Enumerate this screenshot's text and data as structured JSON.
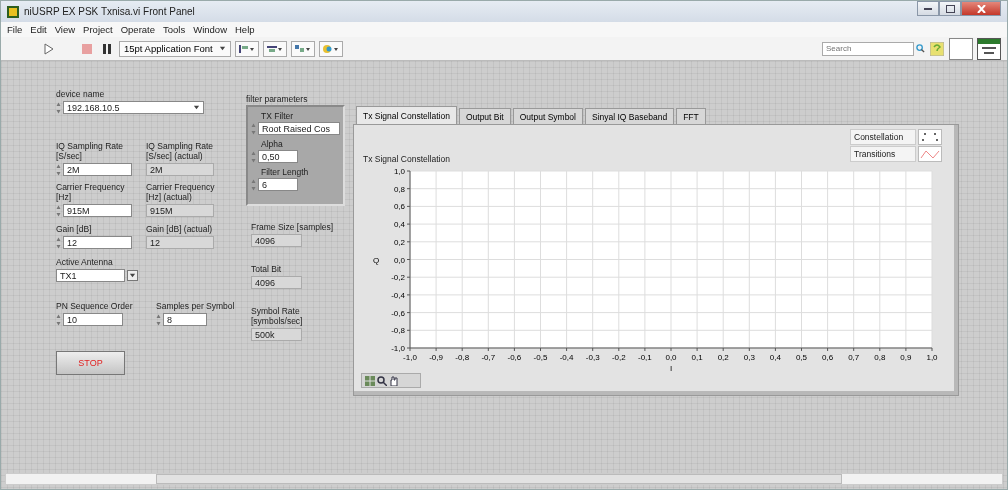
{
  "window": {
    "title": "niUSRP EX PSK Txnisa.vi Front Panel"
  },
  "menu": [
    "File",
    "Edit",
    "View",
    "Project",
    "Operate",
    "Tools",
    "Window",
    "Help"
  ],
  "toolbar": {
    "font": "15pt Application Font",
    "search": {
      "placeholder": "Search"
    }
  },
  "controls": [
    {
      "kind": "ring",
      "label": "device name",
      "value": "192.168.10.5"
    },
    {
      "kind": "numeric",
      "label": "IQ Sampling Rate [S/sec]",
      "value": "2M"
    },
    {
      "kind": "indicator",
      "label": "IQ Sampling Rate [S/sec] (actual)",
      "value": "2M"
    },
    {
      "kind": "numeric",
      "label": "Carrier Frequency [Hz]",
      "value": "915M"
    },
    {
      "kind": "indicator",
      "label": "Carrier Frequency [Hz] (actual)",
      "value": "915M"
    },
    {
      "kind": "numeric",
      "label": "Gain [dB]",
      "value": "12"
    },
    {
      "kind": "indicator",
      "label": "Gain [dB] (actual)",
      "value": "12"
    },
    {
      "kind": "enum",
      "label": "Active Antenna",
      "value": "TX1"
    },
    {
      "kind": "numeric",
      "label": "PN Sequence Order",
      "value": "10"
    },
    {
      "kind": "numeric",
      "label": "Samples per Symbol",
      "value": "8"
    },
    {
      "kind": "button",
      "label": "STOP"
    },
    {
      "kind": "indicator",
      "label": "Frame Size [samples]",
      "value": "4096"
    },
    {
      "kind": "indicator",
      "label": "Total Bit",
      "value": "4096"
    },
    {
      "kind": "indicator",
      "label": "Symbol Rate [symbols/sec]",
      "value": "500k"
    }
  ],
  "filter": {
    "label": "filter parameters",
    "items": [
      {
        "kind": "numeric",
        "label": "TX Filter",
        "value": "Root Raised Cos"
      },
      {
        "kind": "numeric",
        "label": "Alpha",
        "value": "0,50"
      },
      {
        "kind": "numeric",
        "label": "Filter Length",
        "value": "6"
      }
    ]
  },
  "tabs": [
    {
      "label": "Tx Signal Constellation",
      "selected": true
    },
    {
      "label": "Output Bit",
      "selected": false
    },
    {
      "label": "Output Symbol",
      "selected": false
    },
    {
      "label": "Sinyal IQ Baseband",
      "selected": false
    },
    {
      "label": "FFT",
      "selected": false
    }
  ],
  "graph": {
    "legend": [
      {
        "name": "Constellation",
        "kind": "points"
      },
      {
        "name": "Transitions",
        "kind": "line"
      }
    ],
    "chart_data": {
      "type": "scatter",
      "title": "Tx Signal Constellation",
      "xlabel": "I",
      "ylabel": "Q",
      "grid": true,
      "xlim": [
        -1,
        1
      ],
      "ylim": [
        -1,
        1
      ],
      "xticks": [
        {
          "value": -1,
          "label": "-1,0"
        },
        {
          "value": -0.9,
          "label": "-0,9"
        },
        {
          "value": -0.8,
          "label": "-0,8"
        },
        {
          "value": -0.7,
          "label": "-0,7"
        },
        {
          "value": -0.6,
          "label": "-0,6"
        },
        {
          "value": -0.5,
          "label": "-0,5"
        },
        {
          "value": -0.4,
          "label": "-0,4"
        },
        {
          "value": -0.3,
          "label": "-0,3"
        },
        {
          "value": -0.2,
          "label": "-0,2"
        },
        {
          "value": -0.1,
          "label": "-0,1"
        },
        {
          "value": 0,
          "label": "0,0"
        },
        {
          "value": 0.1,
          "label": "0,1"
        },
        {
          "value": 0.2,
          "label": "0,2"
        },
        {
          "value": 0.3,
          "label": "0,3"
        },
        {
          "value": 0.4,
          "label": "0,4"
        },
        {
          "value": 0.5,
          "label": "0,5"
        },
        {
          "value": 0.6,
          "label": "0,6"
        },
        {
          "value": 0.7,
          "label": "0,7"
        },
        {
          "value": 0.8,
          "label": "0,8"
        },
        {
          "value": 0.9,
          "label": "0,9"
        },
        {
          "value": 1,
          "label": "1,0"
        }
      ],
      "yticks": [
        {
          "value": 1,
          "label": "1,0"
        },
        {
          "value": 0.8,
          "label": "0,8"
        },
        {
          "value": 0.6,
          "label": "0,6"
        },
        {
          "value": 0.4,
          "label": "0,4"
        },
        {
          "value": 0.2,
          "label": "0,2"
        },
        {
          "value": 0,
          "label": "0,0"
        },
        {
          "value": -0.2,
          "label": "-0,2"
        },
        {
          "value": -0.4,
          "label": "-0,4"
        },
        {
          "value": -0.6,
          "label": "-0,6"
        },
        {
          "value": -0.8,
          "label": "-0,8"
        },
        {
          "value": -1,
          "label": "-1,0"
        }
      ]
    }
  }
}
